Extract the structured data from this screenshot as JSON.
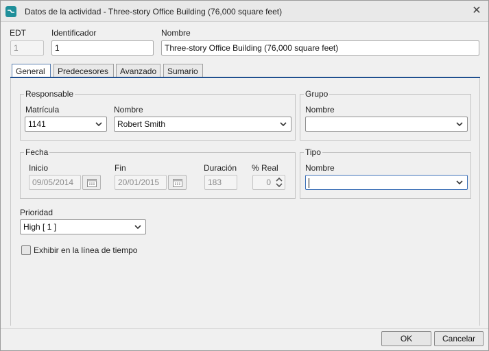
{
  "window": {
    "title": "Datos de la actividad - Three-story Office Building (76,000 square feet)"
  },
  "header": {
    "edt_label": "EDT",
    "edt_value": "1",
    "id_label": "Identificador",
    "id_value": "1",
    "name_label": "Nombre",
    "name_value": "Three-story Office Building (76,000 square feet)"
  },
  "tabs": [
    {
      "label": "General",
      "active": true
    },
    {
      "label": "Predecesores",
      "active": false
    },
    {
      "label": "Avanzado",
      "active": false
    },
    {
      "label": "Sumario",
      "active": false
    }
  ],
  "responsable": {
    "legend": "Responsable",
    "matricula_label": "Matrícula",
    "matricula_value": "1141",
    "nombre_label": "Nombre",
    "nombre_value": "Robert Smith"
  },
  "grupo": {
    "legend": "Grupo",
    "nombre_label": "Nombre",
    "nombre_value": ""
  },
  "fecha": {
    "legend": "Fecha",
    "inicio_label": "Inicio",
    "inicio_value": "09/05/2014",
    "fin_label": "Fin",
    "fin_value": "20/01/2015",
    "duracion_label": "Duración",
    "duracion_value": "183",
    "real_label": "% Real",
    "real_value": "0"
  },
  "tipo": {
    "legend": "Tipo",
    "nombre_label": "Nombre",
    "nombre_value": ""
  },
  "prioridad": {
    "label": "Prioridad",
    "value": "High [ 1 ]"
  },
  "timeline": {
    "label": "Exhibir en la línea de tiempo",
    "checked": false
  },
  "buttons": {
    "ok": "OK",
    "cancel": "Cancelar"
  },
  "colors": {
    "accent": "#1f4f8f",
    "app_icon": "#1f8f9a"
  }
}
